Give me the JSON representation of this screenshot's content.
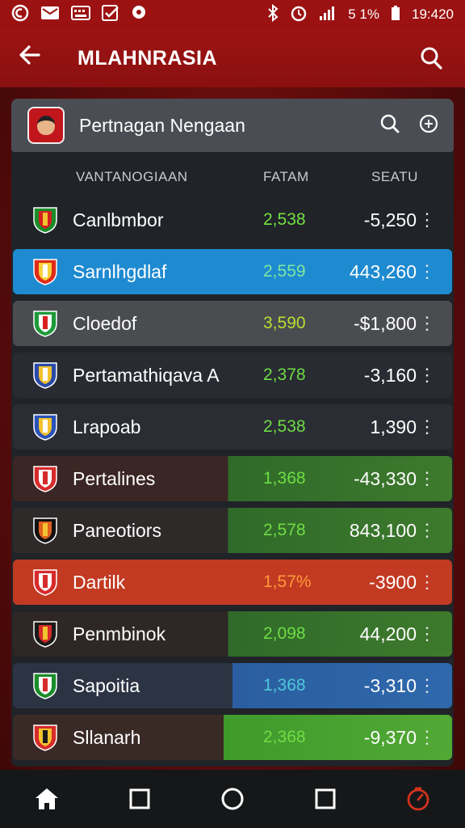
{
  "status_bar": {
    "battery_percent": "5 1%",
    "time": "19:420"
  },
  "app_bar": {
    "title": "MLAHNRASIA"
  },
  "card": {
    "title": "Pertnagan Nengaan"
  },
  "columns": {
    "name": "VANTANOGIAAN",
    "value": "FATAM",
    "score": "SEATU"
  },
  "rows": [
    {
      "name": "Canlbmbor",
      "value": "2,538",
      "score": "-5,250",
      "value_color": "#72e043",
      "bg": "#202328",
      "crest": [
        "#1a8c2a",
        "#d32020",
        "#f2c230"
      ]
    },
    {
      "name": "Sarnlhgdlaf",
      "value": "2,559",
      "score": "443,260",
      "value_color": "#7fe6a0",
      "bg": "#1e8ad0",
      "crest": [
        "#e02a1a",
        "#f6d23a",
        "#ffffff"
      ]
    },
    {
      "name": "Cloedof",
      "value": "3,590",
      "score": "-$1,800",
      "value_color": "#b6e034",
      "bg": "#4a4c50",
      "crest": [
        "#1e9a3a",
        "#ffffff",
        "#d92020"
      ]
    },
    {
      "name": "Pertamathiqava A",
      "value": "2,378",
      "score": "-3,160",
      "value_color": "#6fdc45",
      "bg": "#282b31",
      "crest": [
        "#2a4aa8",
        "#f2c230",
        "#ffffff"
      ]
    },
    {
      "name": "Lrapoab",
      "value": "2,538",
      "score": "1,390",
      "value_color": "#6fdc45",
      "bg": "#2a2e34",
      "crest": [
        "#2a52b8",
        "#f2c230",
        "#ffffff"
      ]
    },
    {
      "name": "Pertalines",
      "value": "1,368",
      "score": "-43,330",
      "value_color": "#6fdc45",
      "bg": "#3a2624",
      "crest": [
        "#d62b2b",
        "#ffffff",
        "#d62b2b"
      ]
    },
    {
      "name": "Paneotiors",
      "value": "2,578",
      "score": "843,100",
      "value_color": "#6fdc45",
      "bg": "#2e2a2a",
      "crest": [
        "#111111",
        "#e06020",
        "#f2c230"
      ]
    },
    {
      "name": "Dartilk",
      "value": "1,57%",
      "score": "-3900",
      "value_color": "#ff9a3a",
      "bg": "#c23a22",
      "crest": [
        "#d62b2b",
        "#ffffff",
        "#d62b2b"
      ]
    },
    {
      "name": "Penmbinok",
      "value": "2,098",
      "score": "44,200",
      "value_color": "#6fdc45",
      "bg": "#2e2726",
      "crest": [
        "#1a1a1a",
        "#d62b2b",
        "#f2c230"
      ]
    },
    {
      "name": "Sapoitia",
      "value": "1,368",
      "score": "-3,310",
      "value_color": "#4fc9d8",
      "bg": "#2c3444",
      "crest": [
        "#1a8c2a",
        "#ffffff",
        "#d62b2b"
      ]
    },
    {
      "name": "Sllanarh",
      "value": "2,368",
      "score": "-9,370",
      "value_color": "#6fdc45",
      "bg": "#3a2a26",
      "crest": [
        "#d62b2b",
        "#f2c230",
        "#1a1a1a"
      ]
    }
  ],
  "colors": {
    "accent_red": "#9c1212",
    "panel": "#202328",
    "value_green": "#6fdc45"
  },
  "icons": {
    "back": "back-arrow-icon",
    "search": "search-icon",
    "share": "share-icon",
    "home": "home-icon",
    "stop": "square-icon",
    "circle": "circle-icon",
    "timer": "stopwatch-icon"
  }
}
